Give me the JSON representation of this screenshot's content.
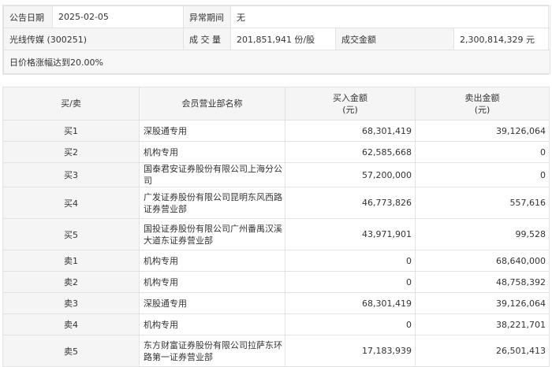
{
  "info": {
    "date_label": "公告日期",
    "date_value": "2025-02-05",
    "anomaly_label": "异常期间",
    "anomaly_value": "无",
    "stock_name": "光线传媒 (300251)",
    "volume_label": "成 交 量",
    "volume_value": "201,851,941 份/股",
    "amount_label": "成交金额",
    "amount_value": "2,300,814,329 元",
    "reason": "日价格涨幅达到20.00%"
  },
  "table": {
    "headers": {
      "side": "买/卖",
      "dept": "会员营业部名称",
      "buy_line1": "买入金额",
      "buy_line2": "(元)",
      "sell_line1": "卖出金额",
      "sell_line2": "(元)"
    },
    "rows": [
      {
        "side": "买1",
        "dept": "深股通专用",
        "buy": "68,301,419",
        "sell": "39,126,064"
      },
      {
        "side": "买2",
        "dept": "机构专用",
        "buy": "62,585,668",
        "sell": "0"
      },
      {
        "side": "买3",
        "dept": "国泰君安证券股份有限公司上海分公司",
        "buy": "57,200,000",
        "sell": "0"
      },
      {
        "side": "买4",
        "dept": "广发证券股份有限公司昆明东风西路证券营业部",
        "buy": "46,773,826",
        "sell": "557,616"
      },
      {
        "side": "买5",
        "dept": "国投证券股份有限公司广州番禺汉溪大道东证券营业部",
        "buy": "43,971,901",
        "sell": "99,528"
      },
      {
        "side": "卖1",
        "dept": "机构专用",
        "buy": "0",
        "sell": "68,640,000"
      },
      {
        "side": "卖2",
        "dept": "机构专用",
        "buy": "0",
        "sell": "48,758,392"
      },
      {
        "side": "卖3",
        "dept": "深股通专用",
        "buy": "68,301,419",
        "sell": "39,126,064"
      },
      {
        "side": "卖4",
        "dept": "机构专用",
        "buy": "0",
        "sell": "38,221,701"
      },
      {
        "side": "卖5",
        "dept": "东方财富证券股份有限公司拉萨东环路第一证券营业部",
        "buy": "17,183,939",
        "sell": "26,501,413"
      }
    ]
  }
}
